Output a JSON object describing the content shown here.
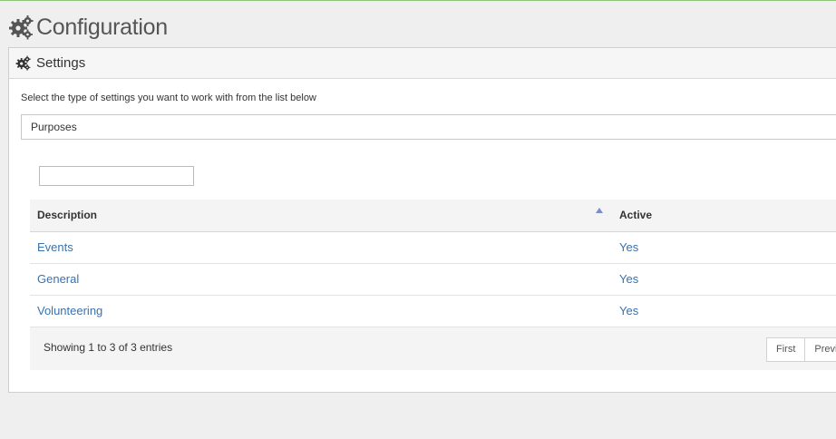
{
  "page": {
    "title": "Configuration"
  },
  "panel": {
    "title": "Settings",
    "instructions": "Select the type of settings you want to work with from the list below",
    "selected_type": "Purposes"
  },
  "search": {
    "value": "",
    "placeholder": ""
  },
  "table": {
    "columns": [
      "Description",
      "Active"
    ],
    "sort": {
      "column": "Description",
      "direction": "asc"
    },
    "rows": [
      {
        "description": "Events",
        "active": "Yes"
      },
      {
        "description": "General",
        "active": "Yes"
      },
      {
        "description": "Volunteering",
        "active": "Yes"
      }
    ],
    "info": "Showing 1 to 3 of 3 entries",
    "pager": {
      "first": "First",
      "previous": "Previous"
    }
  },
  "colors": {
    "link": "#3a72ad",
    "sort_arrow": "#7a8fc9",
    "top_border": "#8fc37a"
  }
}
